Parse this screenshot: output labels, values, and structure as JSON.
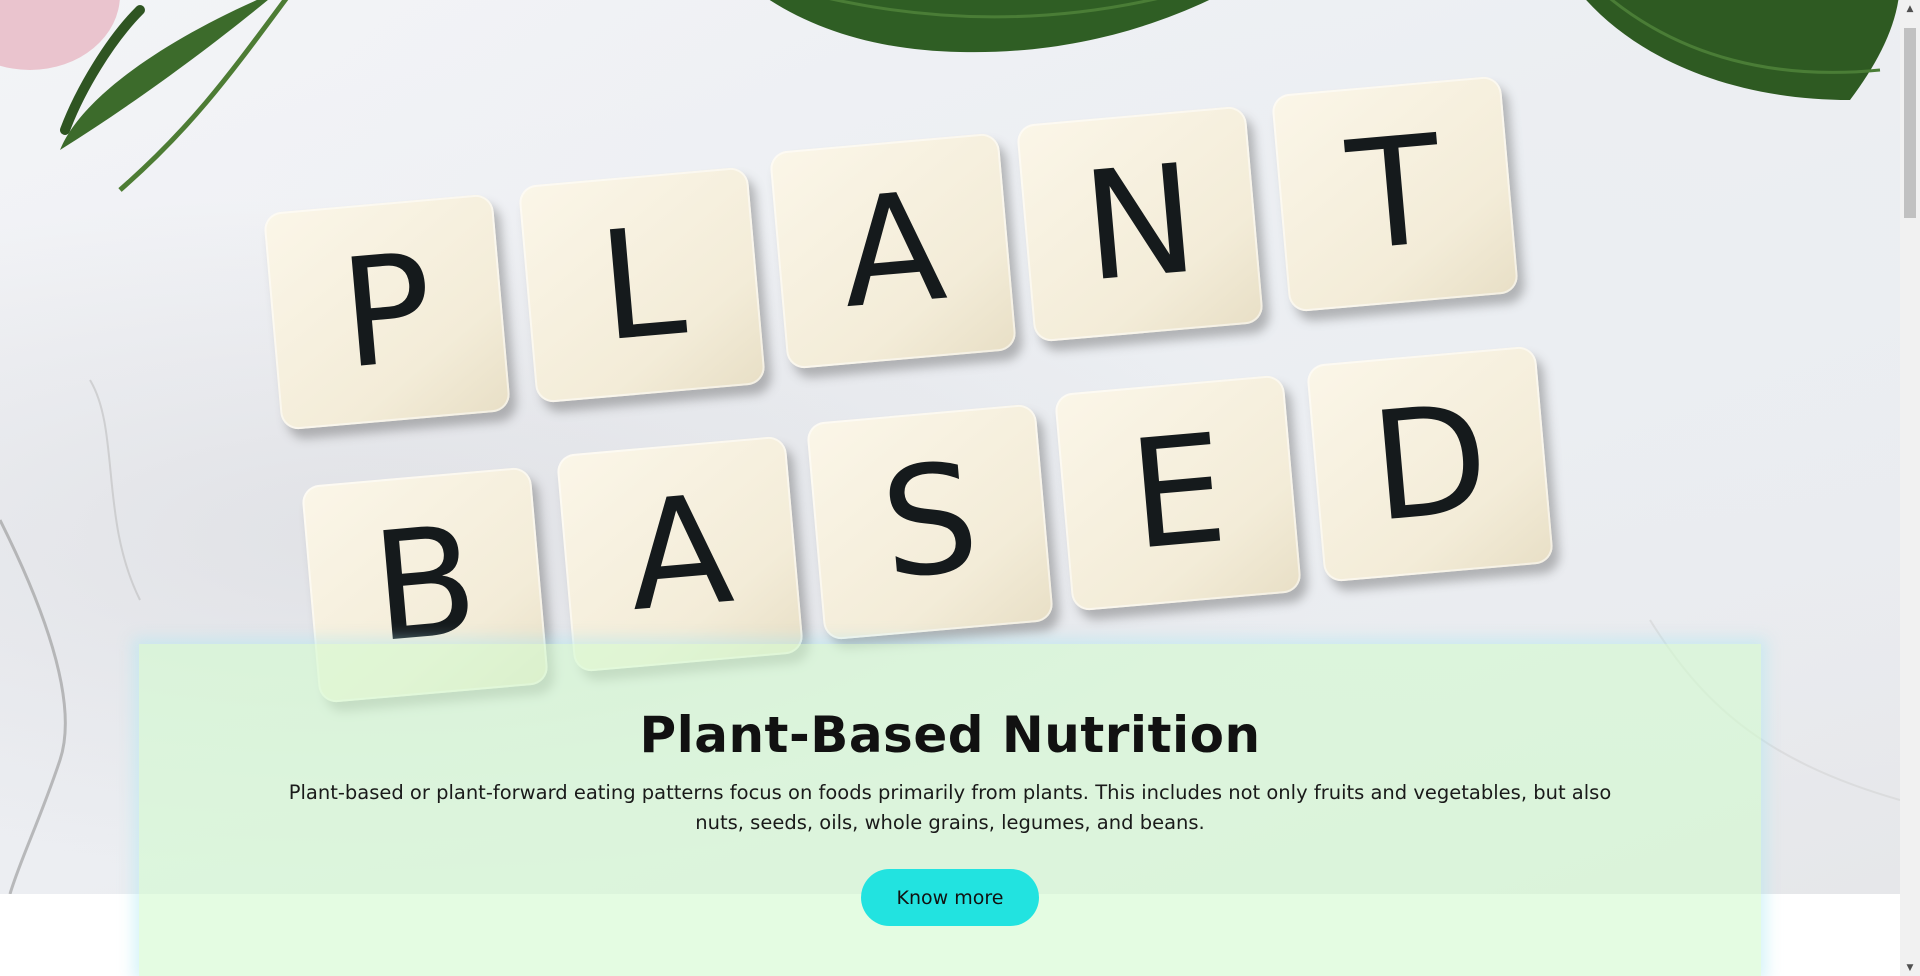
{
  "hero": {
    "image_alt": "Scrabble-style tiles spelling PLANT BASED on white marble with green leaves",
    "tiles_row1": [
      "P",
      "L",
      "A",
      "N",
      "T"
    ],
    "tiles_row2": [
      "B",
      "A",
      "S",
      "E",
      "D"
    ]
  },
  "card": {
    "title": "Plant-Based Nutrition",
    "description": "Plant-based or plant-forward eating patterns focus on foods primarily from plants. This includes not only fruits and vegetables, but also nuts, seeds, oils, whole grains, legumes, and beans.",
    "button_label": "Know more"
  },
  "scrollbar": {
    "up_icon": "triangle-up-icon",
    "down_icon": "triangle-down-icon"
  },
  "colors": {
    "card_background": "#d4fad0",
    "button_background": "#22e3e0",
    "card_glow": "#a8e6f2"
  }
}
